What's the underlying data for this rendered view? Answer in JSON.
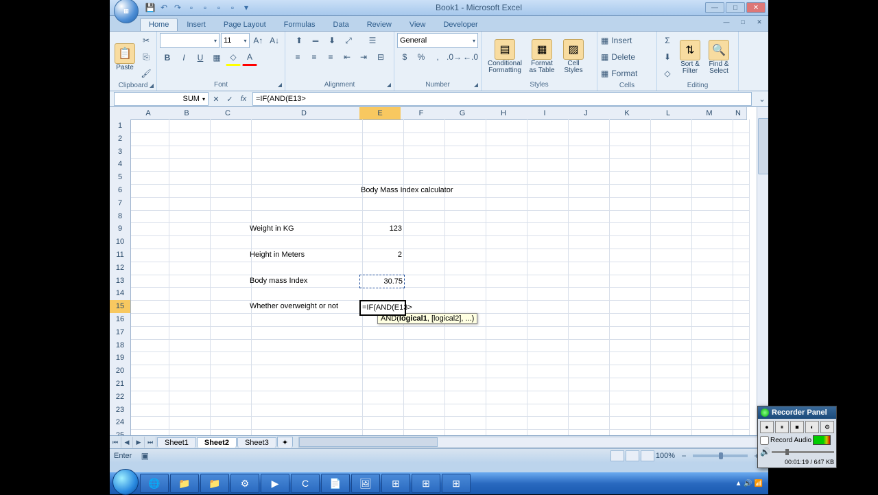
{
  "title": "Book1 - Microsoft Excel",
  "tabs": [
    "Home",
    "Insert",
    "Page Layout",
    "Formulas",
    "Data",
    "Review",
    "View",
    "Developer"
  ],
  "active_tab": 0,
  "ribbon": {
    "clipboard": {
      "paste": "Paste",
      "label": "Clipboard"
    },
    "font": {
      "size": "11",
      "label": "Font"
    },
    "alignment": {
      "label": "Alignment"
    },
    "number": {
      "format": "General",
      "label": "Number"
    },
    "styles": {
      "cond": "Conditional\nFormatting",
      "tbl": "Format\nas Table",
      "cell": "Cell\nStyles",
      "label": "Styles"
    },
    "cells": {
      "insert": "Insert",
      "delete": "Delete",
      "format": "Format",
      "label": "Cells"
    },
    "editing": {
      "sort": "Sort &\nFilter",
      "find": "Find &\nSelect",
      "label": "Editing"
    }
  },
  "namebox": "SUM",
  "formula": "=IF(AND(E13>",
  "columns": [
    "A",
    "B",
    "C",
    "D",
    "E",
    "F",
    "G",
    "H",
    "I",
    "J",
    "K",
    "L",
    "M",
    "N"
  ],
  "col_widths": {
    "A": 52,
    "B": 60,
    "C": 60,
    "D": 162,
    "E": 60,
    "F": 60,
    "G": 60,
    "H": 60,
    "I": 60,
    "J": 60,
    "K": 60,
    "L": 60,
    "M": 60,
    "N": 24
  },
  "rows": 25,
  "row_height": 18.8,
  "chart_data": {
    "type": "table",
    "title": "Body Mass Index calculator",
    "cells": [
      {
        "r": 6,
        "c": "E",
        "v": "Body Mass Index calculator",
        "overflow": true
      },
      {
        "r": 9,
        "c": "D",
        "v": "Weight in KG"
      },
      {
        "r": 9,
        "c": "E",
        "v": "123",
        "align": "r"
      },
      {
        "r": 11,
        "c": "D",
        "v": "Height in Meters"
      },
      {
        "r": 11,
        "c": "E",
        "v": "2",
        "align": "r"
      },
      {
        "r": 13,
        "c": "D",
        "v": "Body mass Index"
      },
      {
        "r": 13,
        "c": "E",
        "v": "30.75",
        "align": "r",
        "ref": true
      },
      {
        "r": 15,
        "c": "D",
        "v": "Whether overweight or not",
        "overflow": true
      },
      {
        "r": 15,
        "c": "E",
        "v": "=IF(AND(E13>",
        "active": true,
        "overflow": true
      }
    ]
  },
  "tooltip": {
    "sig": "AND(",
    "arg1": "logical1",
    "rest": ", [logical2], ...)"
  },
  "sheets": [
    "Sheet1",
    "Sheet2",
    "Sheet3"
  ],
  "active_sheet": 1,
  "status": "Enter",
  "zoom": "100%",
  "recorder": {
    "title": "Recorder Panel",
    "audio": "Record Audio",
    "time": "00:01:19 / 647 KB"
  },
  "tray_time": ""
}
